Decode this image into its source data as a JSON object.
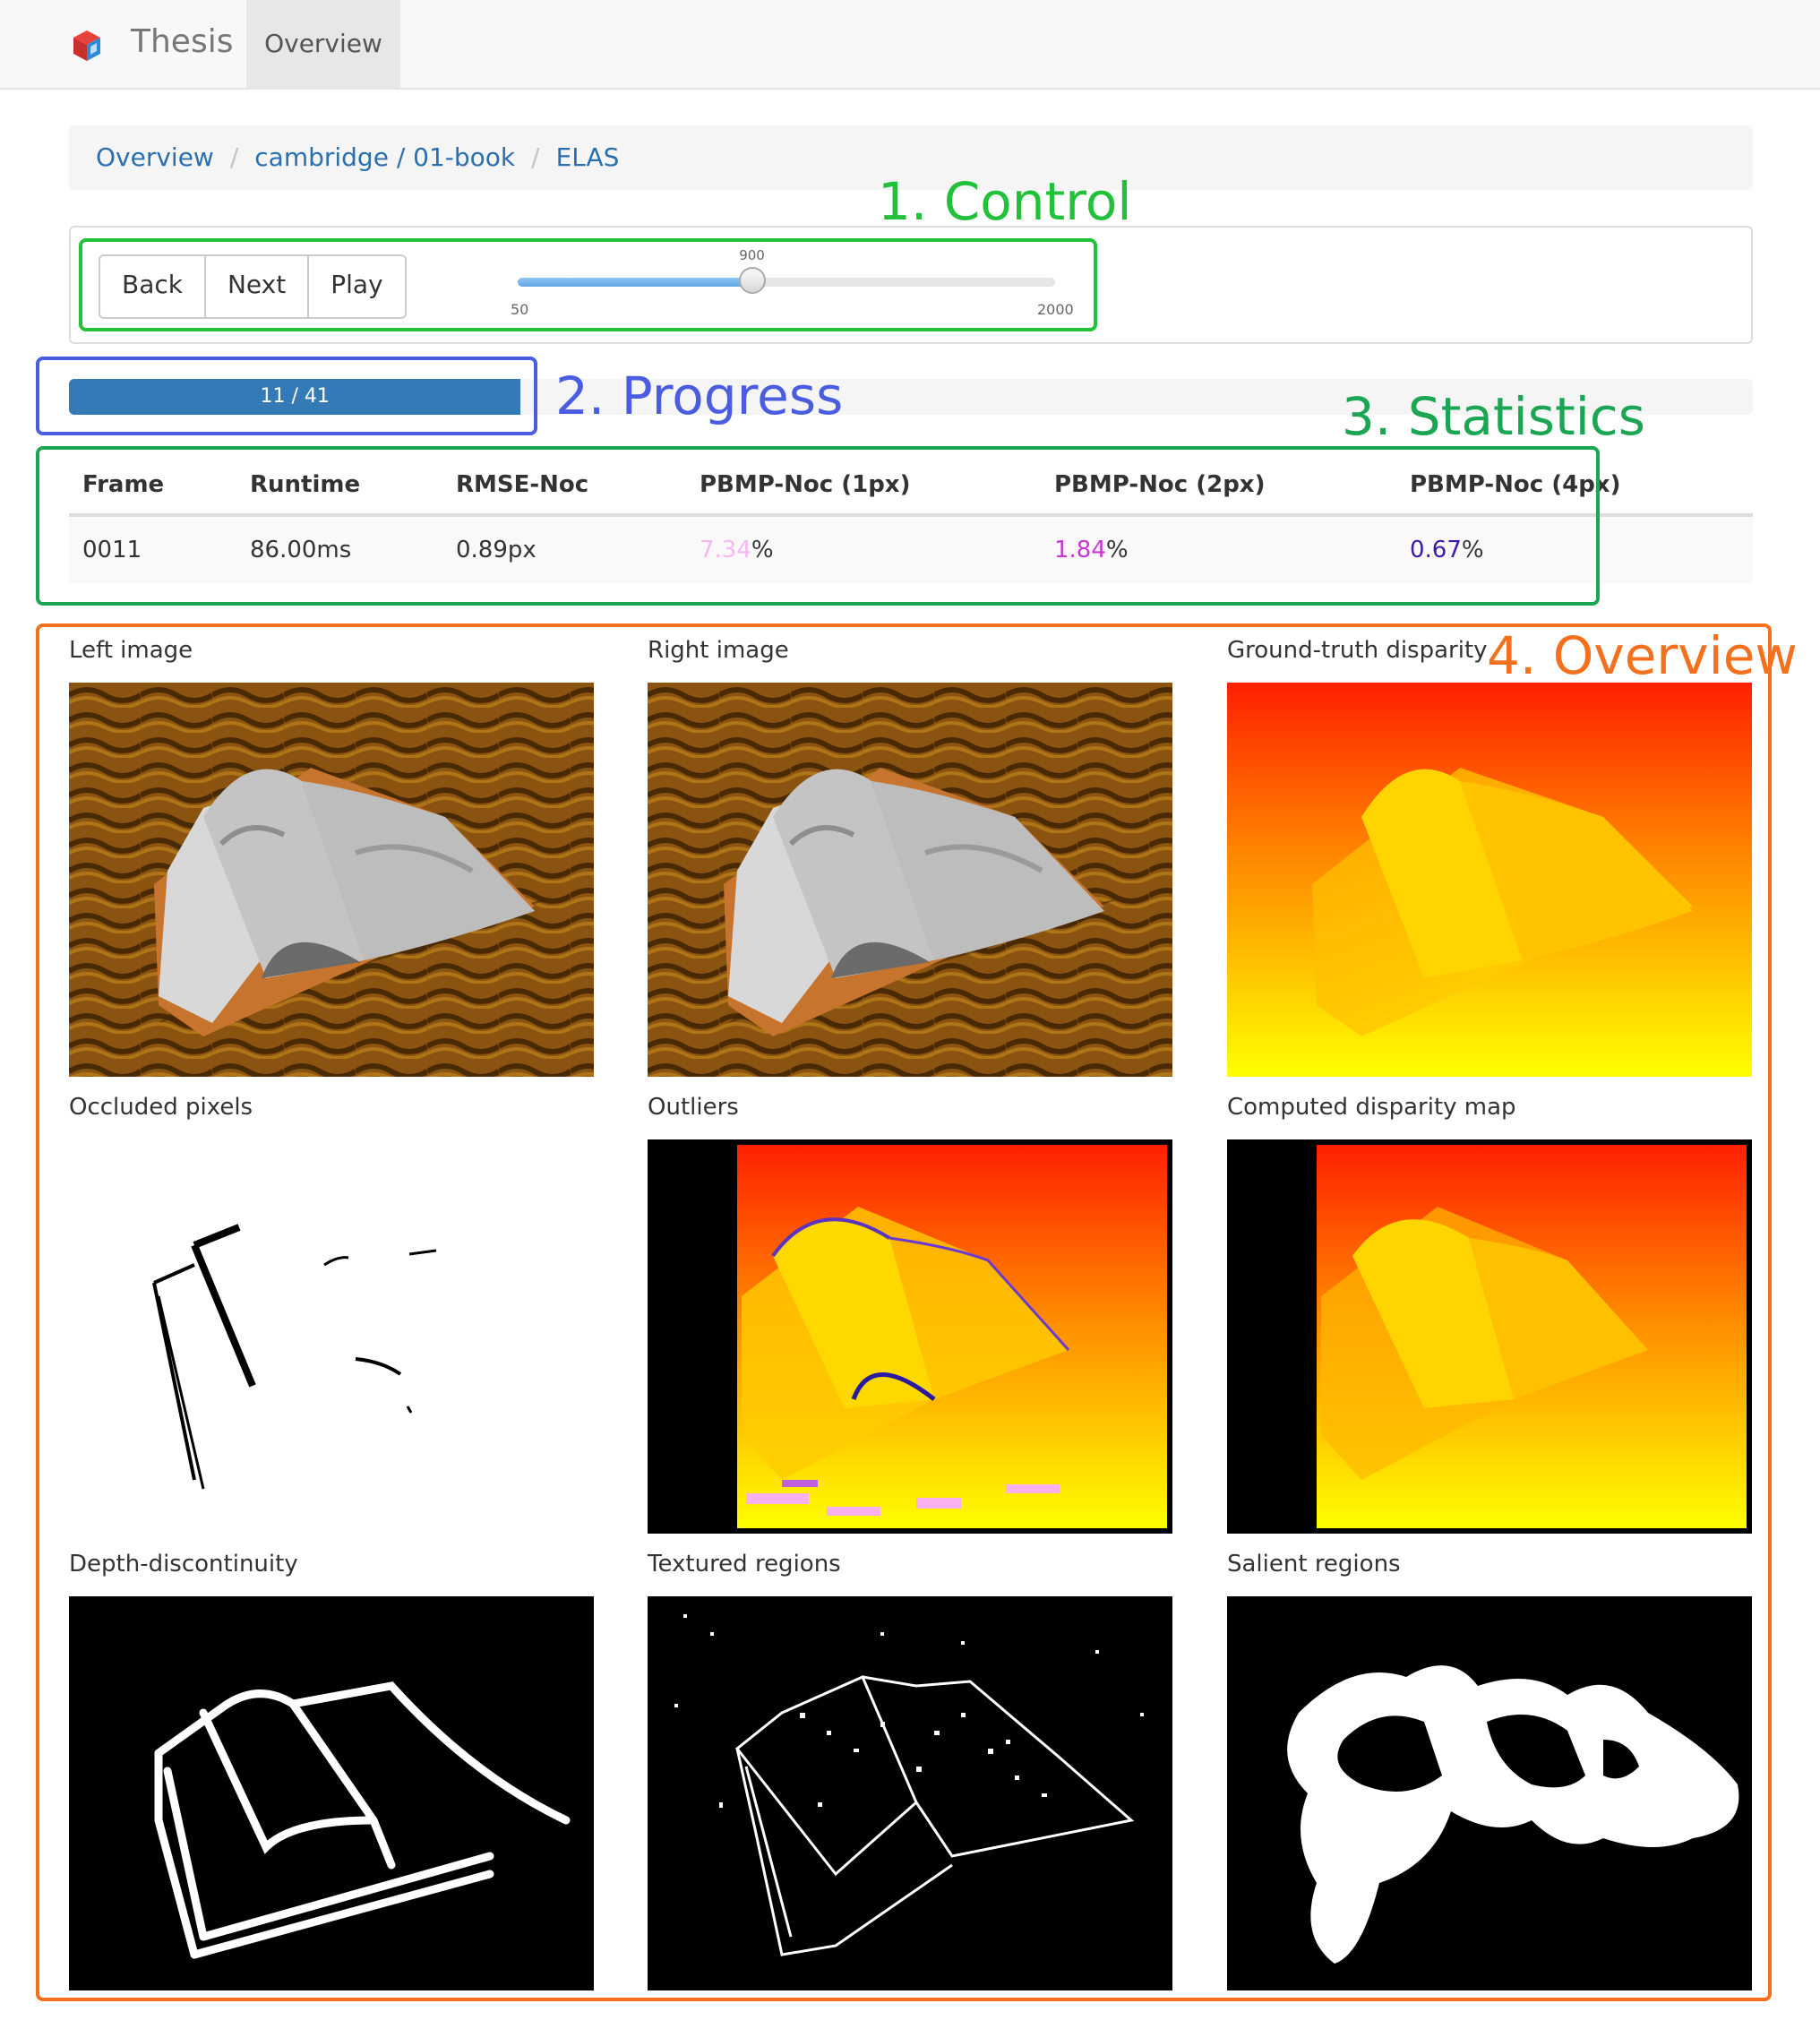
{
  "navbar": {
    "brand": "Thesis",
    "tab": "Overview"
  },
  "breadcrumb": [
    "Overview",
    "cambridge / 01-book",
    "ELAS"
  ],
  "annotations": {
    "control": "1. Control",
    "progress": "2. Progress",
    "statistics": "3. Statistics",
    "overview": "4. Overview"
  },
  "control": {
    "buttons": [
      "Back",
      "Next",
      "Play"
    ],
    "slider": {
      "min": 50,
      "max": 2000,
      "value": 900,
      "min_label": "50",
      "max_label": "2000",
      "value_label": "900"
    }
  },
  "progress": {
    "current": 11,
    "total": 41,
    "label": "11 / 41"
  },
  "stats": {
    "headers": [
      "Frame",
      "Runtime",
      "RMSE-Noc",
      "PBMP-Noc (1px)",
      "PBMP-Noc (2px)",
      "PBMP-Noc (4px)"
    ],
    "frame": "0011",
    "runtime": "86.00ms",
    "rmse": "0.89px",
    "pbmp1": {
      "value": "7.34",
      "unit": "%",
      "color": "#f6b8ee"
    },
    "pbmp2": {
      "value": "1.84",
      "unit": "%",
      "color": "#c837d6"
    },
    "pbmp4": {
      "value": "0.67",
      "unit": "%",
      "color": "#3f1aa8"
    }
  },
  "overview": {
    "titles": [
      "Left image",
      "Right image",
      "Ground-truth disparity",
      "Occluded pixels",
      "Outliers",
      "Computed disparity map",
      "Depth-discontinuity",
      "Textured regions",
      "Salient regions"
    ]
  },
  "colors": {
    "accent": "#337ab7",
    "link": "#2a6fb0",
    "control_annotation": "#22c13a",
    "progress_annotation": "#4a5ce0",
    "statistics_annotation": "#1ca654",
    "overview_annotation": "#f5701c"
  },
  "icons": {
    "brand": "cube-logo-icon"
  }
}
